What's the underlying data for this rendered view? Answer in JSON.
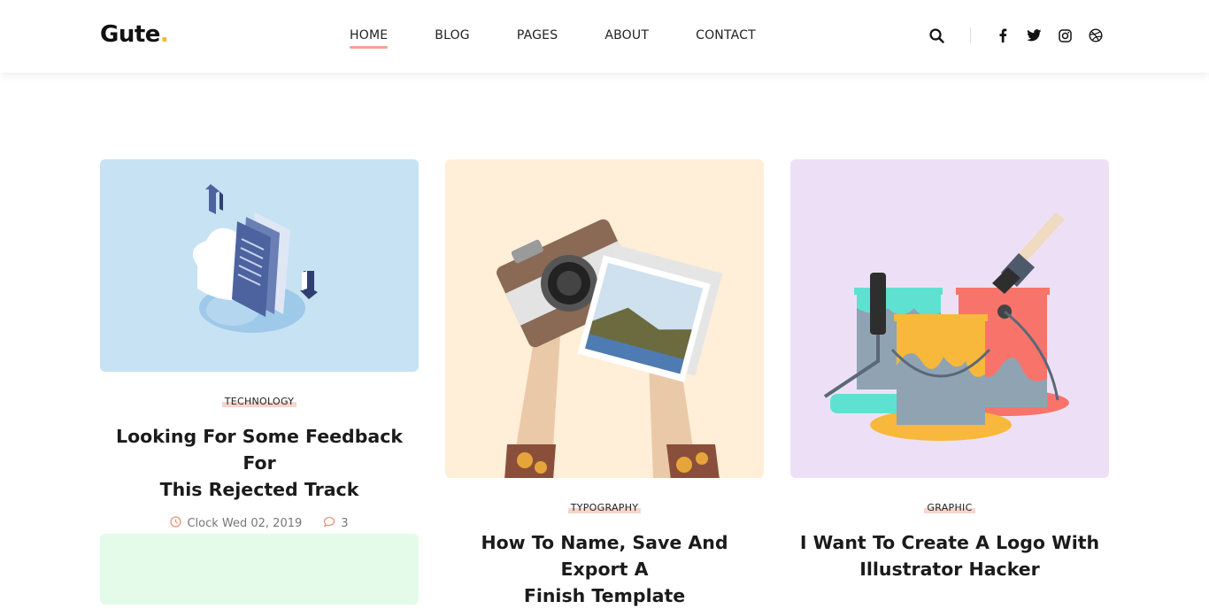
{
  "header": {
    "logo_text": "Gute",
    "logo_dot": ".",
    "nav": [
      {
        "label": "HOME",
        "active": true
      },
      {
        "label": "BLOG",
        "active": false
      },
      {
        "label": "PAGES",
        "active": false
      },
      {
        "label": "ABOUT",
        "active": false
      },
      {
        "label": "CONTACT",
        "active": false
      }
    ],
    "icons": [
      "search-icon",
      "facebook-icon",
      "twitter-icon",
      "instagram-icon",
      "dribbble-icon"
    ]
  },
  "posts": [
    {
      "category": "TECHNOLOGY",
      "title_line1": "Looking For Some Feedback For",
      "title_line2": "This Rejected Track",
      "date": "Clock Wed 02, 2019",
      "comments": "3",
      "thumb_color": "#c7e2f3"
    },
    {
      "category": "TYPOGRAPHY",
      "title_line1": "How To Name, Save And Export A",
      "title_line2": "Finish Template",
      "thumb_color": "#ffeed8"
    },
    {
      "category": "GRAPHIC",
      "title_line1": "I Want To Create A Logo With",
      "title_line2": "Illustrator Hacker",
      "thumb_color": "#ede0f6"
    },
    {
      "thumb_color": "#e5fbe9"
    }
  ],
  "colors": {
    "accent": "#f0a592",
    "logo_dot": "#f5b82e",
    "meta_icon": "#e9957f"
  }
}
